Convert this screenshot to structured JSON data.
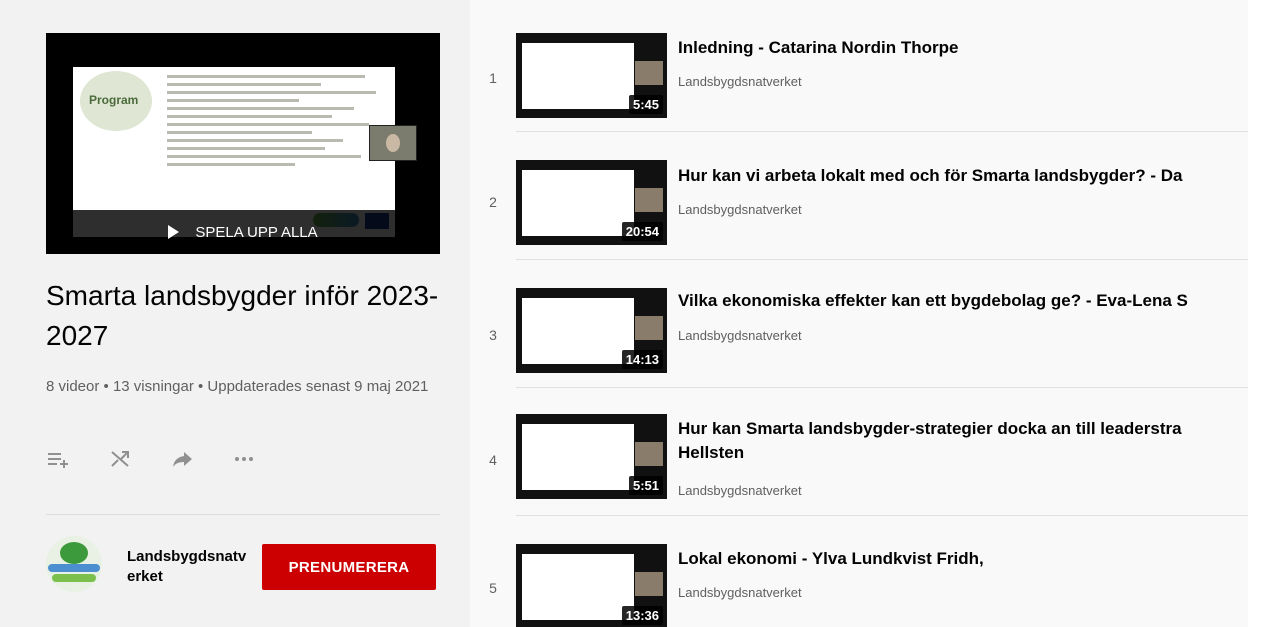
{
  "hero": {
    "play_all_label": "SPELA UPP ALLA",
    "slide_heading": "Program"
  },
  "playlist": {
    "title": "Smarta landsbygder inför 2023-2027",
    "stats": "8 videor • 13 visningar • Uppdaterades senast 9 maj 2021",
    "actions": [
      "add-to-queue-icon",
      "shuffle-icon",
      "share-icon",
      "more-icon"
    ]
  },
  "channel": {
    "name": "Landsbygdsnatverket",
    "subscribe_label": "PRENUMERERA"
  },
  "videos": [
    {
      "index": "1",
      "title": "Inledning - Catarina Nordin Thorpe",
      "channel": "Landsbygdsnatverket",
      "duration": "5:45"
    },
    {
      "index": "2",
      "title": "Hur kan vi arbeta lokalt med och för Smarta landsbygder? - Da",
      "channel": "Landsbygdsnatverket",
      "duration": "20:54"
    },
    {
      "index": "3",
      "title": "Vilka ekonomiska effekter kan ett bygdebolag ge? - Eva-Lena S",
      "channel": "Landsbygdsnatverket",
      "duration": "14:13"
    },
    {
      "index": "4",
      "title": "Hur kan Smarta landsbygder-strategier docka an till leaderstra Hellsten",
      "channel": "Landsbygdsnatverket",
      "duration": "5:51"
    },
    {
      "index": "5",
      "title": "Lokal ekonomi - Ylva Lundkvist Fridh,",
      "channel": "Landsbygdsnatverket",
      "duration": "13:36"
    }
  ],
  "colors": {
    "accent": "#cc0000",
    "sidebar_bg": "#f2f2f2",
    "list_bg": "#f9f9f9"
  }
}
